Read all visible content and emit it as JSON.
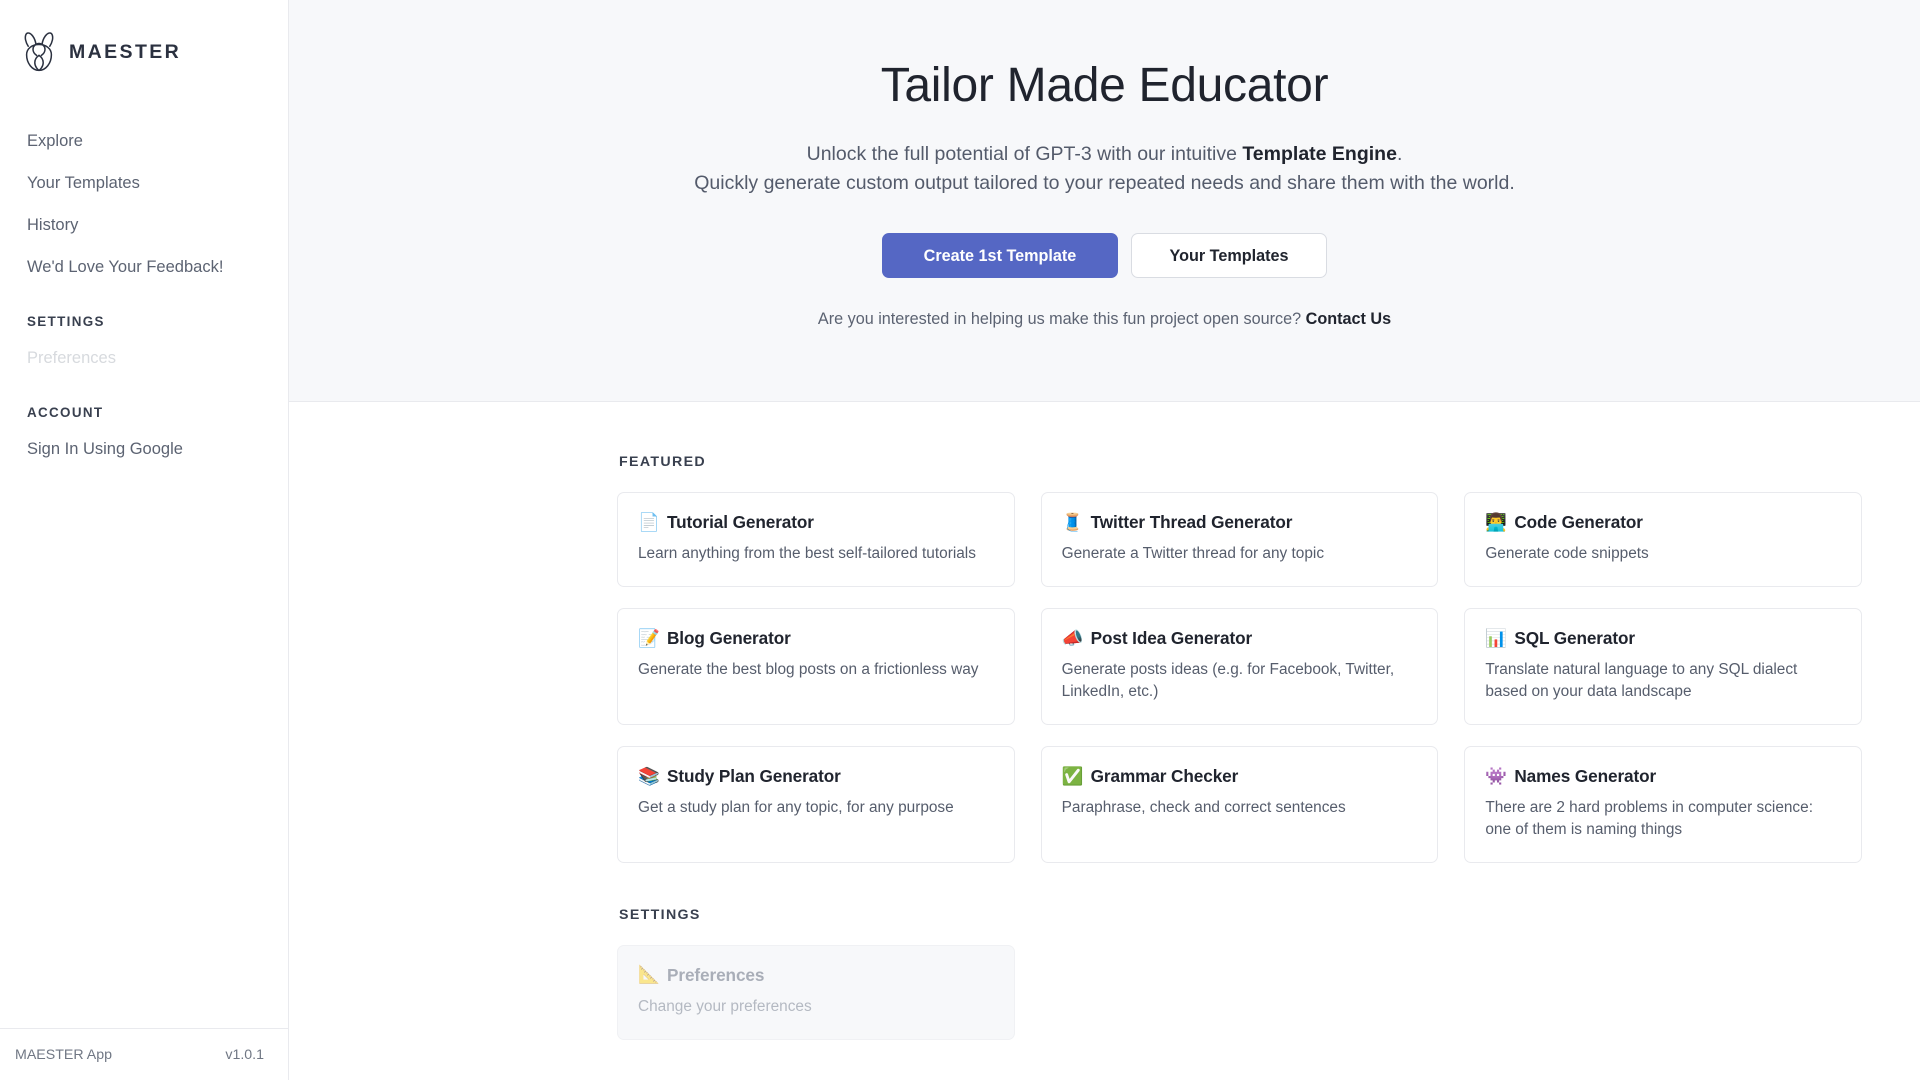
{
  "brand": {
    "name": "MAESTER",
    "logo_icon": "rabbit-logo-icon"
  },
  "sidebar": {
    "nav": [
      {
        "label": "Explore",
        "name": "explore",
        "disabled": false
      },
      {
        "label": "Your Templates",
        "name": "your-templates",
        "disabled": false
      },
      {
        "label": "History",
        "name": "history",
        "disabled": false
      },
      {
        "label": "We'd Love Your Feedback!",
        "name": "feedback",
        "disabled": false
      }
    ],
    "settings_heading": "SETTINGS",
    "settings_items": [
      {
        "label": "Preferences",
        "name": "preferences",
        "disabled": true
      }
    ],
    "account_heading": "ACCOUNT",
    "account_items": [
      {
        "label": "Sign In Using Google",
        "name": "sign-in-using-google",
        "disabled": false
      }
    ],
    "footer": {
      "app_label": "MAESTER App",
      "version": "v1.0.1"
    }
  },
  "hero": {
    "title": "Tailor Made Educator",
    "subtitle_line1_a": "Unlock the full potential of GPT-3 with our intuitive ",
    "subtitle_line1_b": "Template Engine",
    "subtitle_line1_c": ".",
    "subtitle_line2": "Quickly generate custom output tailored to your repeated needs and share them with the world.",
    "primary_button": "Create 1st Template",
    "secondary_button": "Your Templates",
    "note_text": "Are you interested in helping us make this fun project open source?",
    "note_link": "Contact Us"
  },
  "featured": {
    "heading": "FEATURED",
    "cards": [
      {
        "icon": "page-with-curl-icon",
        "emoji": "📄",
        "title": "Tutorial Generator",
        "desc": "Learn anything from the best self-tailored tutorials"
      },
      {
        "icon": "thread-spool-icon",
        "emoji": "🧵",
        "title": "Twitter Thread Generator",
        "desc": "Generate a Twitter thread for any topic"
      },
      {
        "icon": "technologist-icon",
        "emoji": "👨‍💻",
        "title": "Code Generator",
        "desc": "Generate code snippets"
      },
      {
        "icon": "memo-icon",
        "emoji": "📝",
        "title": "Blog Generator",
        "desc": "Generate the best blog posts on a frictionless way"
      },
      {
        "icon": "megaphone-icon",
        "emoji": "📣",
        "title": "Post Idea Generator",
        "desc": "Generate posts ideas (e.g. for Facebook, Twitter, LinkedIn, etc.)"
      },
      {
        "icon": "bar-chart-icon",
        "emoji": "📊",
        "title": "SQL Generator",
        "desc": "Translate natural language to any SQL dialect based on your data landscape"
      },
      {
        "icon": "books-icon",
        "emoji": "📚",
        "title": "Study Plan Generator",
        "desc": "Get a study plan for any topic, for any purpose"
      },
      {
        "icon": "check-mark-button-icon",
        "emoji": "✅",
        "title": "Grammar Checker",
        "desc": "Paraphrase, check and correct sentences"
      },
      {
        "icon": "alien-monster-icon",
        "emoji": "👾",
        "title": "Names Generator",
        "desc": "There are 2 hard problems in computer science: one of them is naming things"
      }
    ]
  },
  "settings_section": {
    "heading": "SETTINGS",
    "cards": [
      {
        "icon": "triangular-ruler-icon",
        "emoji": "📐",
        "title": "Preferences",
        "desc": "Change your preferences",
        "disabled": true
      }
    ]
  },
  "colors": {
    "accent": "#5567c4",
    "hero_bg": "#f7f8fa",
    "border": "#e9eaee",
    "text": "#20242e",
    "muted": "#565d6c"
  }
}
